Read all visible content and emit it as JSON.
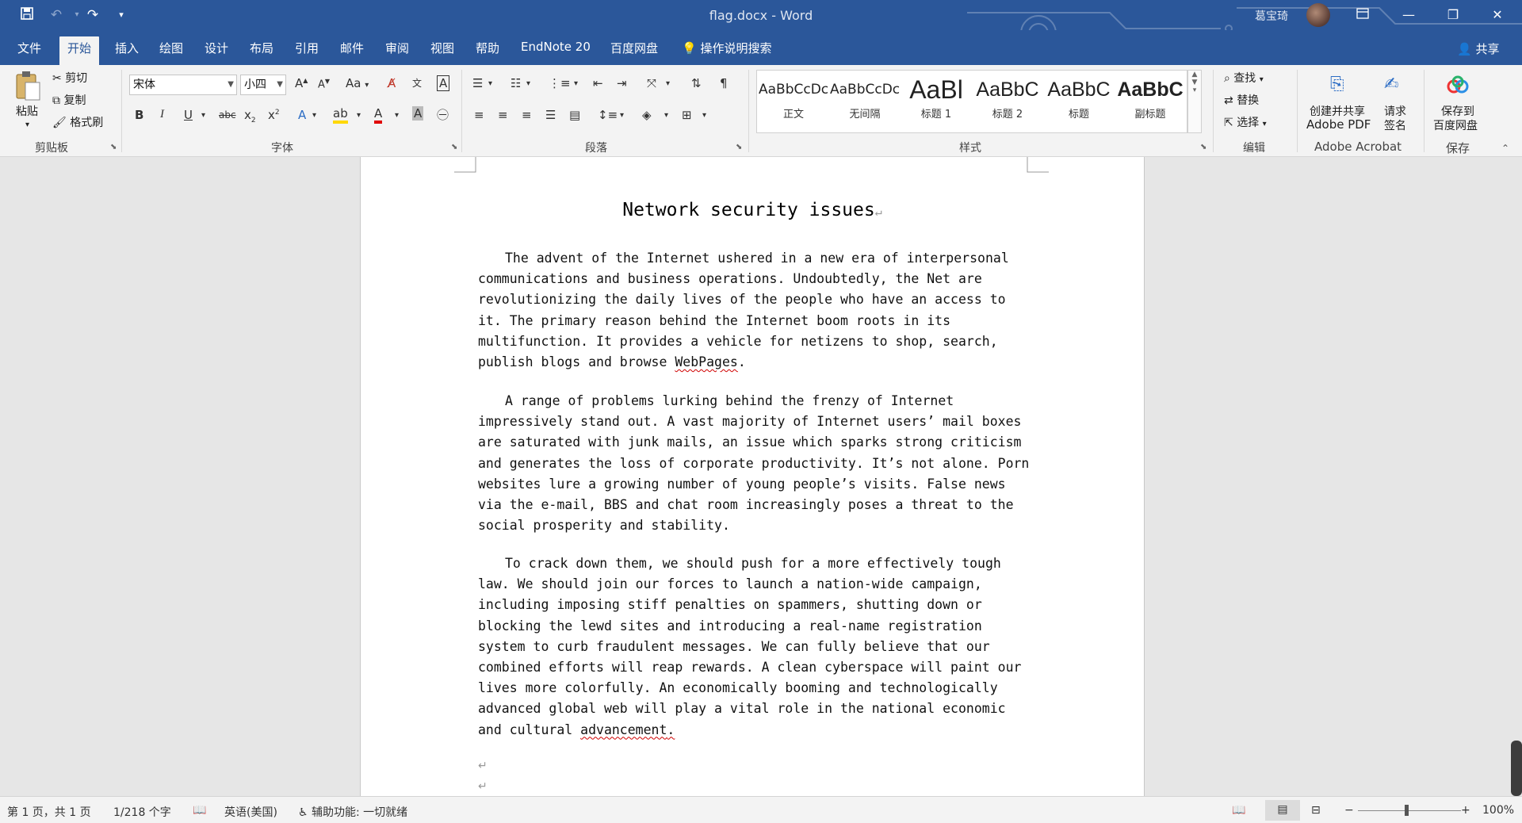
{
  "window": {
    "doc_title": "flag.docx",
    "title_separator": "-",
    "app_name": "Word",
    "user_name": "葛宝琦",
    "accent_color": "#2b579a"
  },
  "quick_access": {
    "save_icon": "save-icon",
    "undo_icon": "undo-icon",
    "redo_icon": "redo-icon",
    "customize_icon": "customize-icon"
  },
  "tabs": [
    {
      "label": "文件"
    },
    {
      "label": "开始"
    },
    {
      "label": "插入"
    },
    {
      "label": "绘图"
    },
    {
      "label": "设计"
    },
    {
      "label": "布局"
    },
    {
      "label": "引用"
    },
    {
      "label": "邮件"
    },
    {
      "label": "审阅"
    },
    {
      "label": "视图"
    },
    {
      "label": "帮助"
    },
    {
      "label": "EndNote 20"
    },
    {
      "label": "百度网盘"
    }
  ],
  "search_label": "操作说明搜索",
  "share_label": "共享",
  "clipboard": {
    "paste_label": "粘贴",
    "cut_label": "剪切",
    "copy_label": "复制",
    "format_painter_label": "格式刷",
    "group_label": "剪贴板"
  },
  "font": {
    "name": "宋体",
    "size": "小四",
    "case_label": "Aa",
    "group_label": "字体"
  },
  "paragraph": {
    "group_label": "段落"
  },
  "styles": {
    "items": [
      {
        "preview": "AaBbCcDc",
        "name": "正文"
      },
      {
        "preview": "AaBbCcDc",
        "name": "无间隔"
      },
      {
        "preview": "AaBl",
        "name": "标题 1"
      },
      {
        "preview": "AaBbC",
        "name": "标题 2"
      },
      {
        "preview": "AaBbC",
        "name": "标题"
      },
      {
        "preview": "AaBbC",
        "name": "副标题"
      }
    ],
    "group_label": "样式"
  },
  "editing": {
    "find_label": "查找",
    "replace_label": "替换",
    "select_label": "选择",
    "group_label": "编辑"
  },
  "acrobat": {
    "create_line1": "创建并共享",
    "create_line2": "Adobe PDF",
    "sign_line1": "请求",
    "sign_line2": "签名",
    "group_label": "Adobe Acrobat"
  },
  "baidu": {
    "save_line1": "保存到",
    "save_line2": "百度网盘",
    "group_label": "保存"
  },
  "document": {
    "heading": "Network security issues",
    "paragraphs": [
      "The advent of the Internet ushered in a new era of interpersonal communications and business operations. Undoubtedly, the Net are revolutionizing the daily lives of the people who have an access to it. The primary reason behind the Internet boom roots in its multifunction. It provides a vehicle for netizens to shop, search, publish blogs and browse ",
      "A range of problems lurking behind the frenzy of Internet impressively stand out. A vast majority of Internet users’ mail boxes are saturated with junk mails, an issue which sparks strong criticism and generates the loss of corporate productivity. It’s not alone. Porn websites lure a growing number of young people’s visits. False news via the e-mail, BBS and chat room increasingly poses a threat to the social prosperity and stability.",
      "To crack down them, we should push for a more effectively tough law. We should join our forces to launch a nation-wide campaign, including imposing stiff penalties on spammers, shutting down or blocking the lewd sites and introducing a real-name registration system to curb fraudulent messages. We can fully believe that our combined efforts will reap rewards. A clean cyberspace will paint our lives more colorfully. An economically booming and technologically advanced global web will play a vital role in the national economic and cultural "
    ],
    "p1_flagged_word": "WebPages",
    "p1_end": ".",
    "p3_flagged_word": "advancement",
    "p3_end": ".",
    "return_mark": "↵"
  },
  "status": {
    "page": "第 1 页，共 1 页",
    "words": "1/218 个字",
    "language": "英语(美国)",
    "accessibility": "辅助功能: 一切就绪",
    "zoom_out": "−",
    "zoom_in": "+",
    "zoom": "100%",
    "zoom_level": 1.0
  }
}
